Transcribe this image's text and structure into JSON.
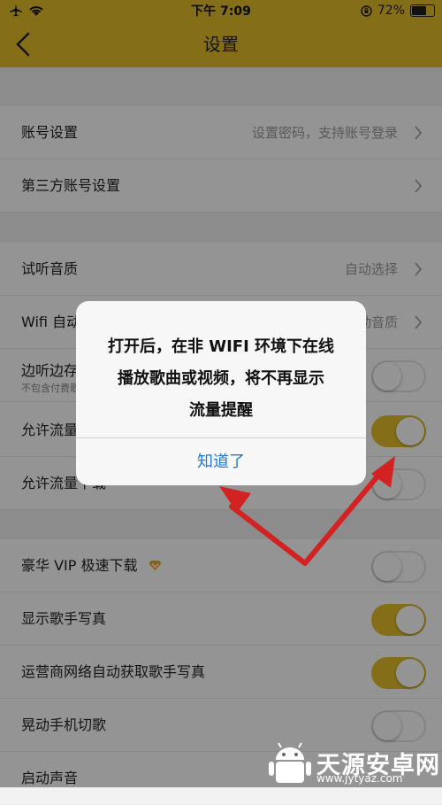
{
  "status_bar": {
    "time": "下午 7:09",
    "battery_percent": "72%",
    "battery_level": 0.72
  },
  "header": {
    "title": "设置"
  },
  "sections": [
    {
      "rows": [
        {
          "label": "账号设置",
          "value": "设置密码，支持账号登录"
        },
        {
          "label": "第三方账号设置",
          "value": ""
        }
      ]
    },
    {
      "rows": [
        {
          "label": "试听音质",
          "value": "自动选择"
        },
        {
          "label": "Wifi 自动下载音质",
          "value": "自动音质"
        },
        {
          "label": "边听边存",
          "sub": "不包含付费歌曲",
          "toggle": false
        },
        {
          "label": "允许流量播放",
          "toggle": true
        },
        {
          "label": "允许流量下载",
          "toggle": false
        }
      ]
    },
    {
      "rows": [
        {
          "label": "豪华 VIP 极速下载",
          "toggle": false
        },
        {
          "label": "显示歌手写真",
          "toggle": true
        },
        {
          "label": "运营商网络自动获取歌手写真",
          "toggle": true
        },
        {
          "label": "晃动手机切歌",
          "toggle": false
        },
        {
          "label": "启动声音"
        }
      ]
    }
  ],
  "dialog": {
    "message_lines": [
      "打开后，在非 WIFI 环境下在线",
      "播放歌曲或视频，将不再显示",
      "流量提醒"
    ],
    "button": "知道了"
  },
  "colors": {
    "accent": "#e4bf2a",
    "link": "#1f7ad6",
    "annotation": "#d32222"
  },
  "watermark": {
    "name": "天源安卓网",
    "url": "www.jytyaz.com"
  }
}
